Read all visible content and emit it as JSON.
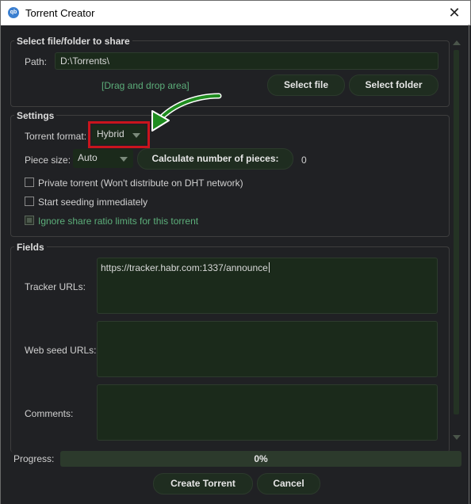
{
  "window": {
    "title": "Torrent Creator",
    "app_icon_text": "qb",
    "close_glyph": "✕"
  },
  "share": {
    "group_title": "Select file/folder to share",
    "path_label": "Path:",
    "path_value": "D:\\Torrents\\",
    "drop_area": "[Drag and drop area]",
    "select_file": "Select file",
    "select_folder": "Select folder"
  },
  "settings": {
    "group_title": "Settings",
    "torrent_format_label": "Torrent format:",
    "torrent_format_value": "Hybrid",
    "piece_size_label": "Piece size:",
    "piece_size_value": "Auto",
    "calc_button": "Calculate number of pieces:",
    "pieces_count": "0",
    "private_torrent": "Private torrent (Won't distribute on DHT network)",
    "start_seeding": "Start seeding immediately",
    "ignore_ratio": "Ignore share ratio limits for this torrent",
    "private_checked": false,
    "start_seeding_checked": false,
    "ignore_ratio_disabled": true
  },
  "fields": {
    "group_title": "Fields",
    "tracker_label": "Tracker URLs:",
    "tracker_value": "https://tracker.habr.com:1337/announce",
    "webseed_label": "Web seed URLs:",
    "comments_label": "Comments:"
  },
  "footer": {
    "progress_label": "Progress:",
    "progress_text": "0%",
    "progress_value": 0,
    "create_button": "Create Torrent",
    "cancel_button": "Cancel"
  },
  "annotation": {
    "highlight_color": "#c9141d",
    "arrow_color": "#1f8c1f"
  },
  "colors": {
    "background": "#202124",
    "field_bg": "#1b2a1b",
    "button_bg": "#1f2d20",
    "accent_text": "#5cae7a"
  }
}
